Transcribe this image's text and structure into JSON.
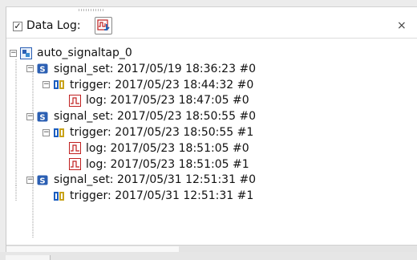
{
  "toolbar": {
    "data_log_checked": true,
    "data_log_label": "Data Log:",
    "close_symbol": "×"
  },
  "tree": [
    {
      "level": 0,
      "text": "auto_signaltap_0",
      "icon": "instance-icon",
      "toggle": "−"
    },
    {
      "level": 1,
      "text": "signal_set: 2017/05/19 18:36:23  #0",
      "icon": "signal-set-icon",
      "toggle": "−"
    },
    {
      "level": 2,
      "text": "trigger: 2017/05/23 18:44:32  #0",
      "icon": "trigger-icon",
      "toggle": "−"
    },
    {
      "level": 3,
      "text": "log: 2017/05/23 18:47:05  #0",
      "icon": "log-icon",
      "toggle": ""
    },
    {
      "level": 1,
      "text": "signal_set: 2017/05/23 18:50:55  #0",
      "icon": "signal-set-icon",
      "toggle": "−"
    },
    {
      "level": 2,
      "text": "trigger: 2017/05/23 18:50:55  #1",
      "icon": "trigger-icon",
      "toggle": "−"
    },
    {
      "level": 3,
      "text": "log: 2017/05/23 18:51:05  #0",
      "icon": "log-icon",
      "toggle": ""
    },
    {
      "level": 3,
      "text": "log: 2017/05/23 18:51:05  #1",
      "icon": "log-icon",
      "toggle": ""
    },
    {
      "level": 1,
      "text": "signal_set: 2017/05/31 12:51:31  #0",
      "icon": "signal-set-icon",
      "toggle": "−"
    },
    {
      "level": 2,
      "text": "trigger: 2017/05/31 12:51:31  #1",
      "icon": "trigger-icon",
      "toggle": ""
    }
  ]
}
